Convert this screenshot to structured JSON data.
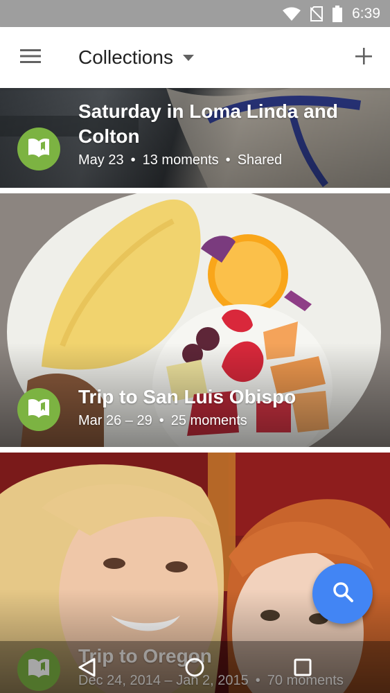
{
  "status_bar": {
    "time": "6:39",
    "icons": [
      "wifi-icon",
      "no-sim-icon",
      "battery-icon"
    ]
  },
  "app_bar": {
    "menu_icon": "hamburger-menu-icon",
    "title": "Collections",
    "dropdown_icon": "dropdown-arrow-icon",
    "add_icon": "plus-icon"
  },
  "collections": [
    {
      "title": "Saturday in Loma Linda and Colton",
      "date": "May 23",
      "moments": "13 moments",
      "shared": "Shared",
      "icon": "album-book-icon"
    },
    {
      "title": "Trip to San Luis Obispo",
      "date": "Mar 26 – 29",
      "moments": "25 moments",
      "icon": "album-book-icon"
    },
    {
      "title": "Trip to Oregon",
      "date": "Dec 24, 2014 – Jan 2, 2015",
      "moments": "70 moments",
      "icon": "album-book-icon"
    }
  ],
  "fab": {
    "icon": "search-icon"
  },
  "nav_bar": {
    "icons": [
      "back-icon",
      "home-icon",
      "recents-icon"
    ]
  },
  "colors": {
    "status_bar": "#9e9e9e",
    "collection_icon": "#7cb342",
    "fab": "#4285f4"
  }
}
